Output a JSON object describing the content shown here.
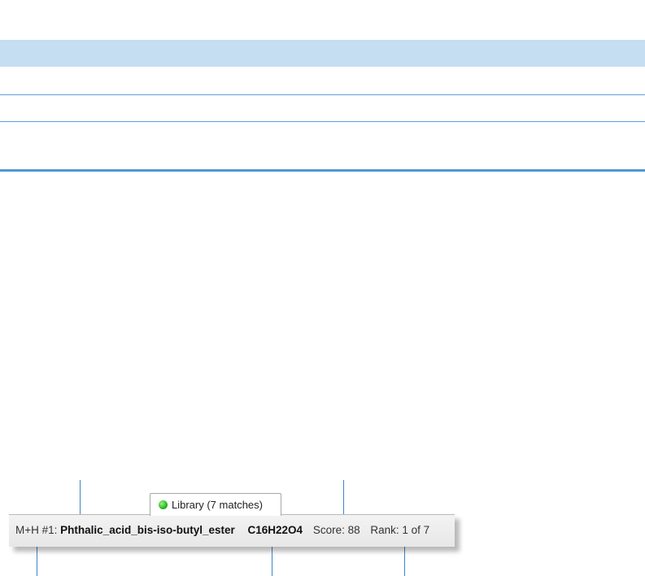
{
  "colors": {
    "header_band": "#c5def2",
    "row_lines": "#5fa0d6",
    "leader_lines": "#3f84c8",
    "status_indicator": "#1fb31f"
  },
  "library_tab": {
    "icon": "green-status-dot-icon",
    "label": "Library (7 matches)"
  },
  "status_bar": {
    "adduct_label": "M+H #1:",
    "compound_name": "Phthalic_acid_bis-iso-butyl_ester",
    "formula": "C16H22O4",
    "score_text": "Score: 88",
    "rank_text": "Rank: 1 of 7"
  }
}
